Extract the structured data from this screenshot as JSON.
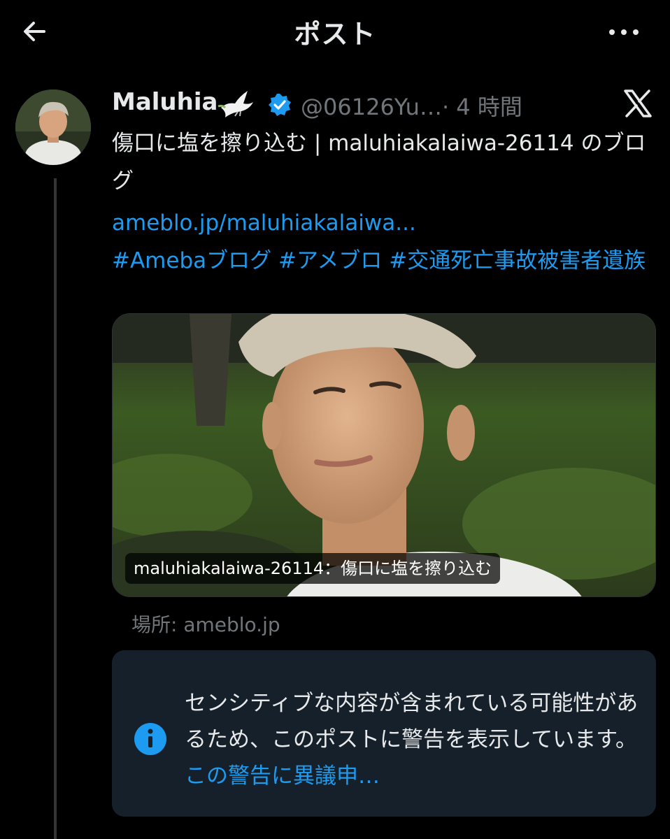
{
  "topbar": {
    "title": "ポスト",
    "back_icon": "arrow-left-icon",
    "more_icon": "more-horizontal-icon"
  },
  "post": {
    "display_name": "Maluhia",
    "name_emoji": "dove-icon",
    "verified_icon": "verified-badge-icon",
    "handle": "@06126Yu…",
    "time": "· 4 時間",
    "source_icon": "x-logo-icon",
    "text": "傷口に塩を擦り込む | maluhiakalaiwa-26114 のブログ",
    "link": "ameblo.jp/maluhiakalaiwa...",
    "hashtags": "#Amebaブログ #アメブロ #交通死亡事故被害者遺族"
  },
  "card": {
    "caption": "maluhiakalaiwa-26114：傷口に塩を擦り込む",
    "source": "場所: ameblo.jp"
  },
  "notice": {
    "icon": "info-icon",
    "text": "センシティブな内容が含まれている可能性があるため、このポストに警告を表示しています。",
    "link": "この警告に異議申…"
  },
  "colors": {
    "background": "#000000",
    "text": "#e7e9ea",
    "secondary": "#71767b",
    "accent": "#1d9bf0",
    "notice_bg": "#16202a"
  }
}
